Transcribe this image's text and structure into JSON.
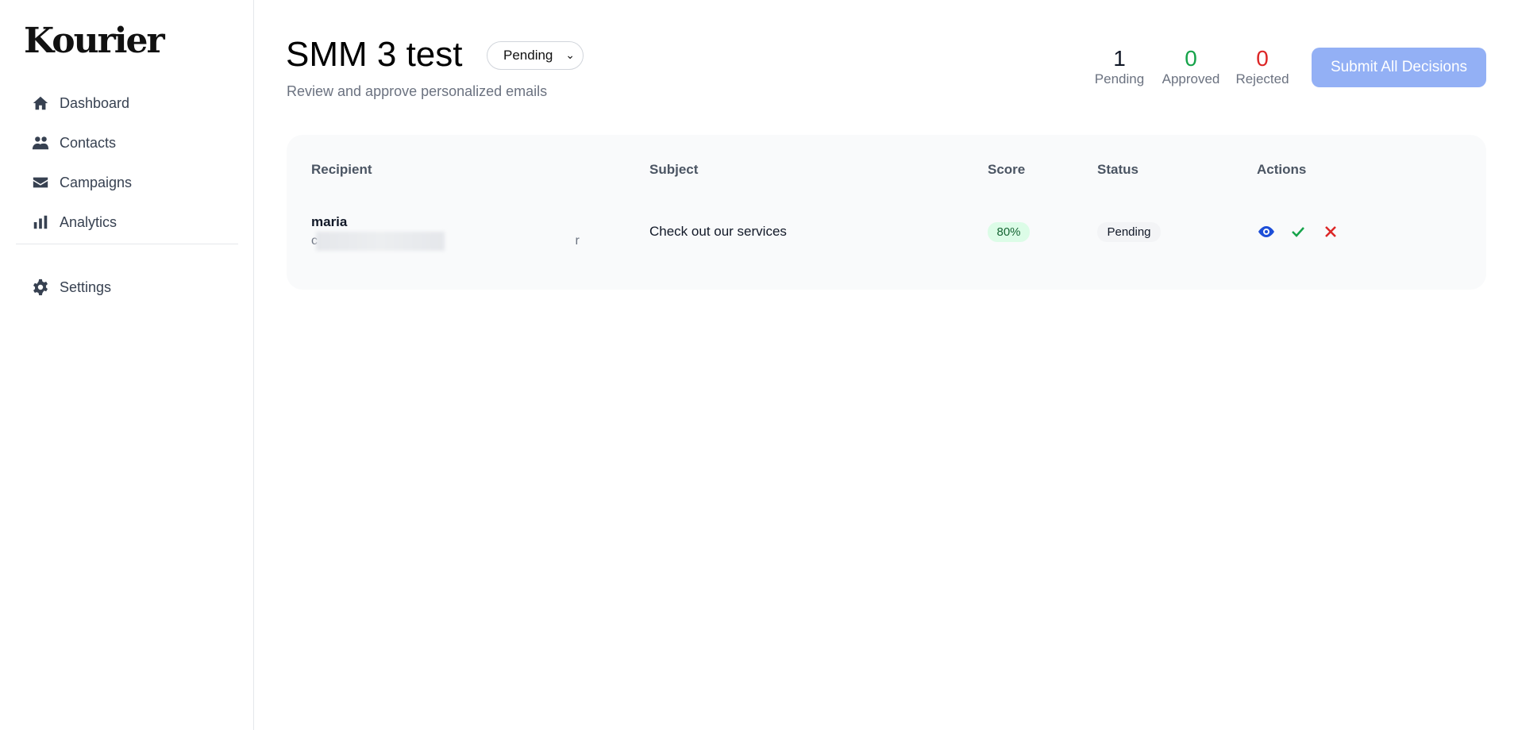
{
  "sidebar": {
    "logo": "Kourier",
    "items": [
      {
        "label": "Dashboard",
        "icon": "home-icon"
      },
      {
        "label": "Contacts",
        "icon": "users-icon"
      },
      {
        "label": "Campaigns",
        "icon": "envelope-icon"
      },
      {
        "label": "Analytics",
        "icon": "bar-chart-icon"
      }
    ],
    "settings": {
      "label": "Settings",
      "icon": "gear-icon"
    }
  },
  "header": {
    "title": "SMM 3 test",
    "filter": "Pending",
    "subtitle": "Review and approve personalized emails"
  },
  "stats": [
    {
      "value": "1",
      "label": "Pending",
      "color": "#111827"
    },
    {
      "value": "0",
      "label": "Approved",
      "color": "#16a34a"
    },
    {
      "value": "0",
      "label": "Rejected",
      "color": "#dc2626"
    }
  ],
  "submit_label": "Submit All Decisions",
  "table": {
    "columns": [
      "Recipient",
      "Subject",
      "Score",
      "Status",
      "Actions"
    ],
    "rows": [
      {
        "name": "maria",
        "email_visible": "c r",
        "subject": "Check out our services",
        "score": "80%",
        "status": "Pending"
      }
    ]
  },
  "colors": {
    "accent": "#93b0f5",
    "view": "#1d4ed8",
    "approve": "#16a34a",
    "reject": "#dc2626"
  }
}
